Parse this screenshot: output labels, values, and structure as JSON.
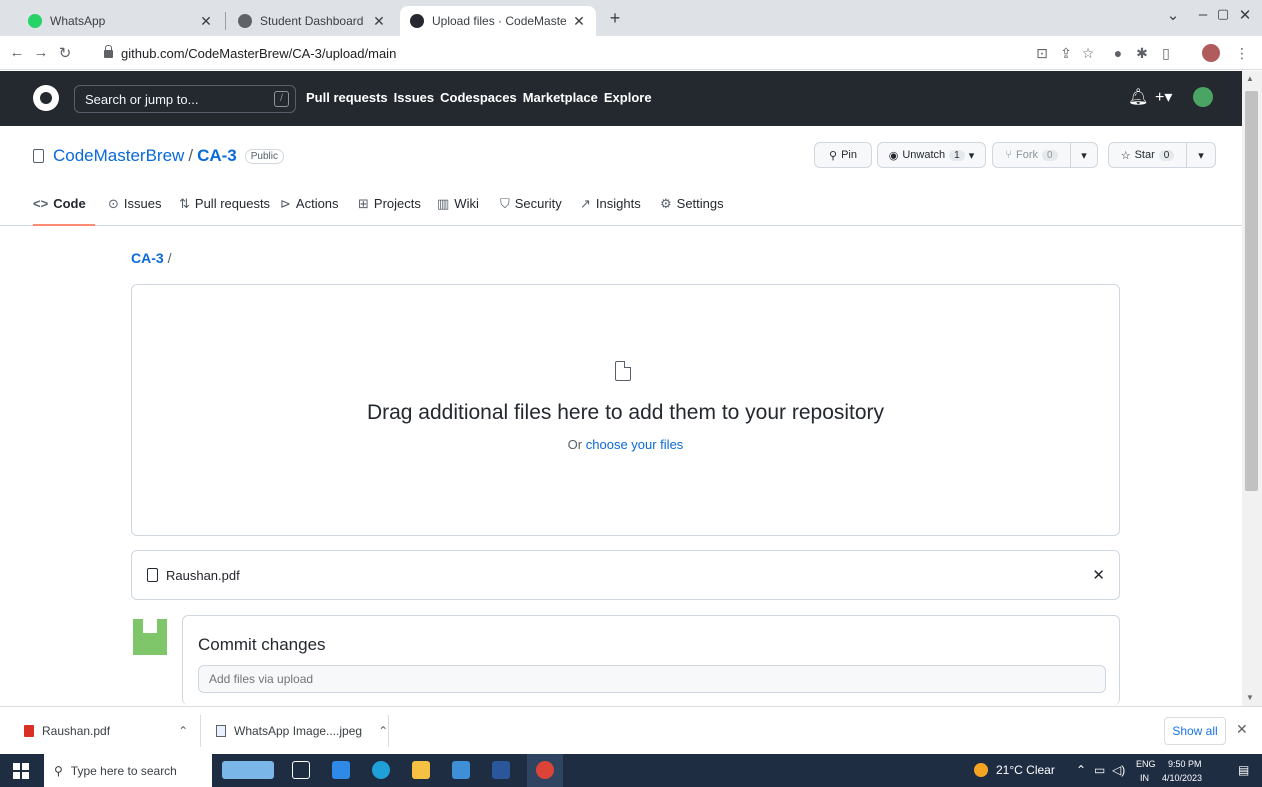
{
  "browser": {
    "tabs": [
      {
        "label": "WhatsApp",
        "active": false
      },
      {
        "label": "Student Dashboard",
        "active": false
      },
      {
        "label": "Upload files · CodeMasterBrew/C",
        "active": true
      }
    ],
    "new_tab": "+",
    "url": "github.com/CodeMasterBrew/CA-3/upload/main"
  },
  "github": {
    "search_placeholder": "Search or jump to...",
    "search_shortcut": "/",
    "nav": [
      "Pull requests",
      "Issues",
      "Codespaces",
      "Marketplace",
      "Explore"
    ],
    "plus": "+",
    "repo": {
      "owner": "CodeMasterBrew",
      "separator": "/",
      "name": "CA-3",
      "visibility": "Public",
      "pin": "Pin",
      "watch": "Unwatch",
      "watch_count": "1",
      "fork": "Fork",
      "fork_count": "0",
      "star": "Star",
      "star_count": "0"
    },
    "tabs": [
      "Code",
      "Issues",
      "Pull requests",
      "Actions",
      "Projects",
      "Wiki",
      "Security",
      "Insights",
      "Settings"
    ]
  },
  "upload": {
    "breadcrumb_repo": "CA-3",
    "breadcrumb_sep": "/",
    "drop_title": "Drag additional files here to add them to your repository",
    "drop_or": "Or",
    "drop_link": "choose your files",
    "file_name": "Raushan.pdf",
    "commit_title": "Commit changes",
    "commit_placeholder": "Add files via upload"
  },
  "downloads": {
    "items": [
      "Raushan.pdf",
      "WhatsApp Image....jpeg"
    ],
    "show_all": "Show all"
  },
  "taskbar": {
    "search_placeholder": "Type here to search",
    "weather": "21°C  Clear",
    "lang_top": "ENG",
    "lang_bottom": "IN",
    "time": "9:50 PM",
    "date": "4/10/2023"
  },
  "colors": {
    "github_header": "#24292f",
    "link": "#0969da",
    "active_tab_underline": "#fd8c73",
    "taskbar": "#1f2d43"
  }
}
